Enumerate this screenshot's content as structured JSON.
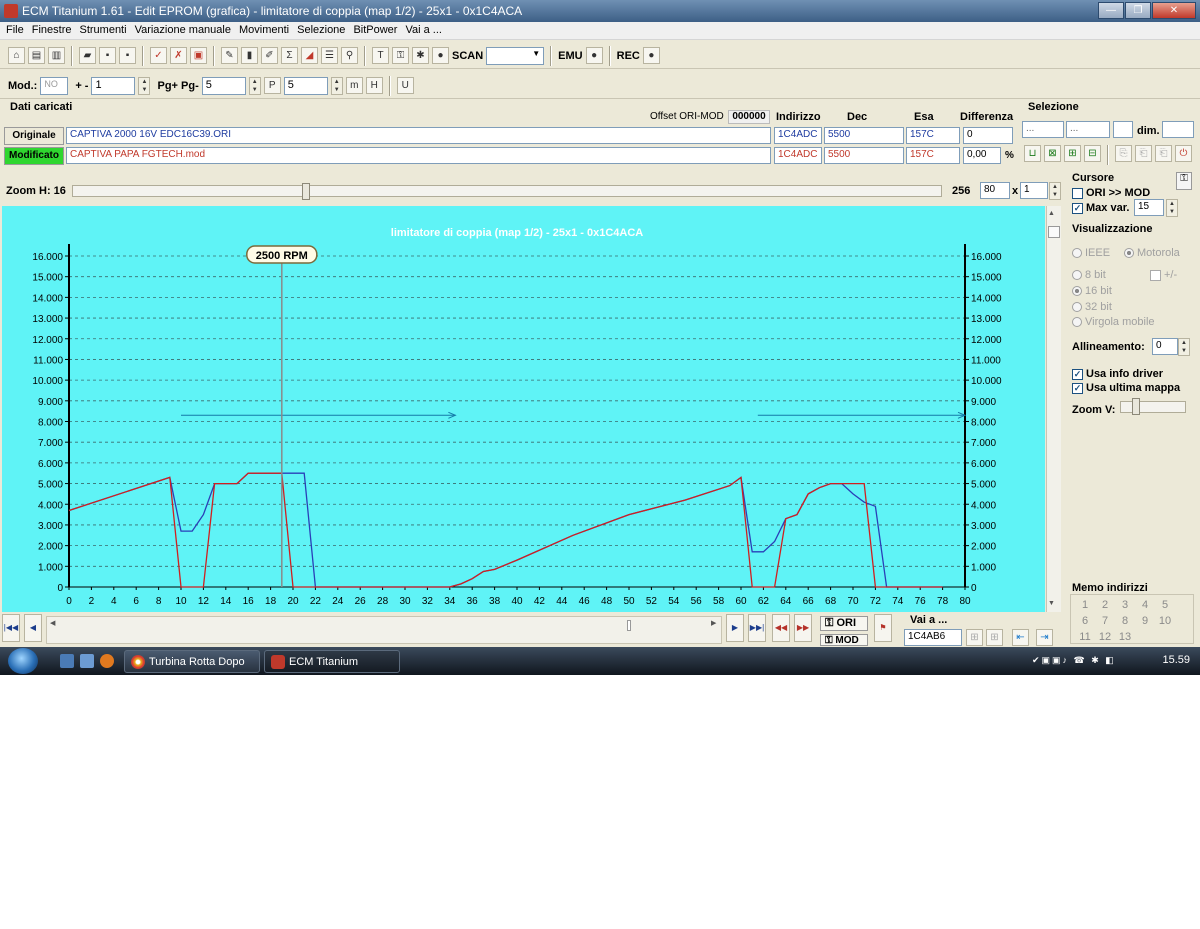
{
  "window": {
    "title": "ECM Titanium 1.61 - Edit EPROM (grafica) - limitatore di coppia (map 1/2) - 25x1 - 0x1C4ACA"
  },
  "menu": [
    "File",
    "Finestre",
    "Strumenti",
    "Variazione manuale",
    "Movimenti",
    "Selezione",
    "BitPower",
    "Vai a ..."
  ],
  "toolbar": {
    "scan_label": "SCAN",
    "emu_label": "EMU",
    "rec_label": "REC",
    "sigma": "Σ"
  },
  "toolbar2": {
    "mod_label": "Mod.:",
    "mod_value": "NO",
    "plusminus_label": "+ -",
    "plusminus_value": "1",
    "pg_label": "Pg+ Pg-",
    "pg_value": "5",
    "step_value": "5"
  },
  "data": {
    "title": "Dati caricati",
    "offset_label": "Offset ORI-MOD",
    "offset_value": "000000",
    "headers": {
      "indirizzo": "Indirizzo",
      "dec": "Dec",
      "esa": "Esa",
      "differenza": "Differenza"
    },
    "originale": {
      "label": "Originale",
      "file": "CAPTIVA 2000 16V EDC16C39.ORI",
      "indirizzo": "1C4ADC",
      "dec": "5500",
      "esa": "157C",
      "differenza": "0"
    },
    "modificato": {
      "label": "Modificato",
      "file": "CAPTIVA PAPA FGTECH.mod",
      "indirizzo": "1C4ADC",
      "dec": "5500",
      "esa": "157C",
      "differenza": "0,00",
      "unit": "%"
    }
  },
  "selezione": {
    "title": "Selezione",
    "field1": "...",
    "field2": "...",
    "dim_label": "dim."
  },
  "zoom": {
    "label": "Zoom H: 16",
    "value": "256",
    "box1": "80",
    "times": "x",
    "box2": "1"
  },
  "cursore": {
    "title": "Cursore",
    "ori_mod_label": "ORI >> MOD",
    "ori_mod_checked": false,
    "maxvar_label": "Max var.",
    "maxvar_checked": true,
    "maxvar_value": "15"
  },
  "visualizzazione": {
    "title": "Visualizzazione",
    "ieee": "IEEE",
    "motorola": "Motorola",
    "bit8": "8 bit",
    "plusminus": "+/-",
    "bit16": "16 bit",
    "bit32": "32 bit",
    "virgola": "Virgola mobile",
    "allineamento_label": "Allineamento:",
    "allineamento_value": "0",
    "usa_info_driver": "Usa info driver",
    "usa_ultima_mappa": "Usa ultima mappa",
    "zoom_v_label": "Zoom V:"
  },
  "memo": {
    "title": "Memo indirizzi",
    "numbers": [
      "1",
      "2",
      "3",
      "4",
      "5",
      "6",
      "7",
      "8",
      "9",
      "10",
      "11",
      "12",
      "13"
    ]
  },
  "nav": {
    "ori_label": "ORI",
    "mod_label": "MOD",
    "vai_label": "Vai a ...",
    "vai_value": "1C4AB6"
  },
  "taskbar": {
    "task1": "Turbina Rotta Dopo ...",
    "task2": "ECM Titanium",
    "clock": "15.59"
  },
  "colors": {
    "chart_bg": "#5ff3f6",
    "original_series": "#2a3fb8",
    "modified_series": "#d11f1f",
    "cursor_line": "#8a8a8a",
    "arrow": "#147aa8"
  },
  "chart_data": {
    "type": "line",
    "title": "limitatore di coppia (map 1/2) - 25x1 - 0x1C4ACA",
    "cursor_label": "2500 RPM",
    "cursor_x": 19,
    "xlim": [
      0,
      80
    ],
    "ylim": [
      0,
      16000
    ],
    "x_ticks": [
      0,
      2,
      4,
      6,
      8,
      10,
      12,
      14,
      16,
      18,
      20,
      22,
      24,
      26,
      28,
      30,
      32,
      34,
      36,
      38,
      40,
      42,
      44,
      46,
      48,
      50,
      52,
      54,
      56,
      58,
      60,
      62,
      64,
      66,
      68,
      70,
      72,
      74,
      76,
      78,
      80
    ],
    "y_ticks": [
      "0",
      "1.000",
      "2.000",
      "3.000",
      "4.000",
      "5.000",
      "6.000",
      "7.000",
      "8.000",
      "9.000",
      "10.000",
      "11.000",
      "12.000",
      "13.000",
      "14.000",
      "15.000",
      "16.000"
    ],
    "y_tick_values": [
      0,
      1000,
      2000,
      3000,
      4000,
      5000,
      6000,
      7000,
      8000,
      9000,
      10000,
      11000,
      12000,
      13000,
      14000,
      15000,
      16000
    ],
    "arrows": [
      {
        "x1": 10,
        "x2": 34.5,
        "y": 8300
      },
      {
        "x1": 61.5,
        "x2": 80,
        "y": 8300
      }
    ],
    "series": [
      {
        "x": [
          0,
          9,
          10,
          11,
          12,
          13,
          14,
          15,
          16,
          17,
          18,
          19,
          20,
          21,
          22,
          23,
          34,
          35,
          36,
          37,
          38,
          40,
          45,
          50,
          55,
          59,
          60,
          61,
          62,
          63,
          64,
          65,
          66,
          67,
          68,
          69,
          70,
          71,
          72,
          73,
          74,
          78
        ],
        "y": [
          3700,
          5300,
          2700,
          2700,
          3500,
          5000,
          5000,
          5000,
          5500,
          5500,
          5500,
          5500,
          5500,
          5500,
          0,
          0,
          0,
          150,
          400,
          750,
          850,
          1300,
          2500,
          3500,
          4200,
          4900,
          5300,
          1700,
          1700,
          2200,
          3300,
          3500,
          4500,
          4800,
          5000,
          5000,
          4500,
          4100,
          3900,
          0,
          0,
          0
        ]
      },
      {
        "x": [
          0,
          9,
          10,
          11,
          12,
          13,
          14,
          15,
          16,
          17,
          18,
          19,
          20,
          21,
          22,
          23,
          34,
          35,
          36,
          37,
          38,
          40,
          45,
          50,
          55,
          59,
          60,
          61,
          62,
          63,
          64,
          65,
          66,
          67,
          68,
          69,
          70,
          71,
          72,
          73,
          74,
          78
        ],
        "y": [
          3700,
          5300,
          0,
          0,
          0,
          5000,
          5000,
          5000,
          5500,
          5500,
          5500,
          5500,
          0,
          0,
          0,
          0,
          0,
          150,
          400,
          750,
          850,
          1300,
          2500,
          3500,
          4200,
          4900,
          5300,
          0,
          0,
          0,
          3300,
          3500,
          4500,
          4800,
          5000,
          5000,
          5000,
          5000,
          0,
          0,
          0,
          0
        ]
      }
    ]
  }
}
